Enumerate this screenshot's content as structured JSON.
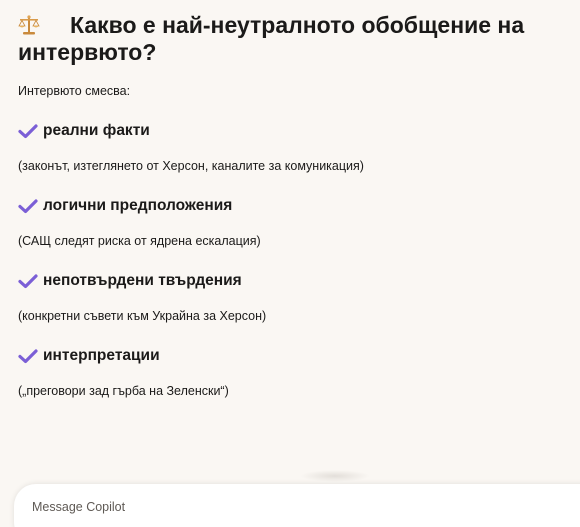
{
  "heading": {
    "icon": "balance-scale-icon",
    "text": "Какво е най-неутралното обобщение на интервюто?"
  },
  "intro": "Интервюто смесва:",
  "items": [
    {
      "icon": "check-icon",
      "title": "реални факти",
      "note": "(законът, изтеглянето от Херсон, каналите за комуникация)"
    },
    {
      "icon": "check-icon",
      "title": "логични предположения",
      "note": "(САЩ следят риска от ядрена ескалация)"
    },
    {
      "icon": "check-icon",
      "title": "непотвърдени твърдения",
      "note": "(конкретни съвети към Украйна за Херсон)"
    },
    {
      "icon": "check-icon",
      "title": "интерпретации",
      "note": "(„преговори зад гърба на Зеленски“)"
    }
  ],
  "composer": {
    "placeholder": "Message Copilot"
  },
  "colors": {
    "background": "#faf7f3",
    "check": "#7b5fd6",
    "text": "#1b1a19"
  }
}
